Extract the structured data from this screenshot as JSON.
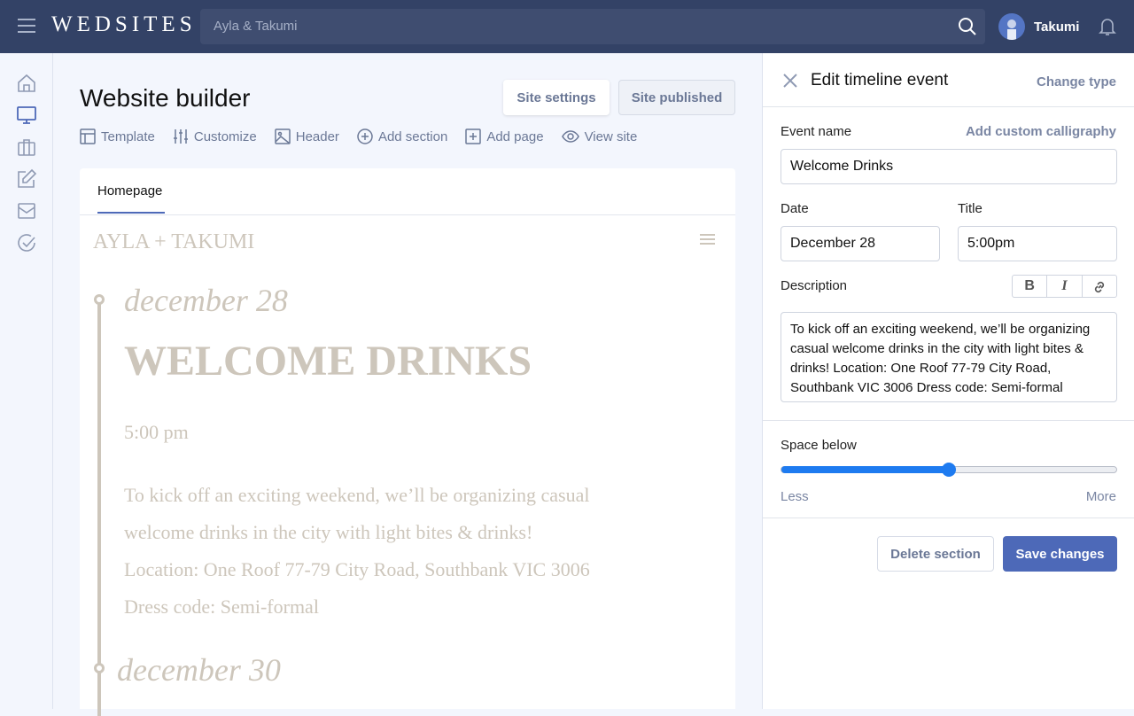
{
  "topbar": {
    "logo": "WEDSITES",
    "search_value": "Ayla & Takumi",
    "user": "Takumi"
  },
  "sidebar": {
    "items": [
      "home-icon",
      "monitor-icon",
      "briefcase-icon",
      "edit-icon",
      "mail-icon",
      "check-circle-icon"
    ],
    "active": "monitor-icon"
  },
  "main": {
    "title": "Website builder",
    "site_settings": "Site settings",
    "site_published": "Site published",
    "tools": [
      "Template",
      "Customize",
      "Header",
      "Add section",
      "Add page",
      "View site"
    ],
    "tab": "Homepage"
  },
  "preview": {
    "couple": "AYLA + TAKUMI",
    "date": "december 28",
    "event": "WELCOME DRINKS",
    "time": "5:00 pm",
    "description": [
      "To kick off an exciting weekend, we’ll be organizing casual",
      "welcome drinks in the city with light bites & drinks!",
      "Location: One Roof 77-79 City Road, Southbank VIC 3006",
      "Dress code: Semi-formal"
    ],
    "next_date": "december 30"
  },
  "panel": {
    "title": "Edit timeline event",
    "change_type": "Change type",
    "event_name_label": "Event name",
    "custom_calligraphy": "Add custom calligraphy",
    "event_name": "Welcome Drinks",
    "date_label": "Date",
    "date": "December 28",
    "title_label": "Title",
    "title_value": "5:00pm",
    "description_label": "Description",
    "description": "To kick off an exciting weekend, we’ll be organizing casual welcome drinks in the city with light bites & drinks! Location: One Roof 77-79 City Road, Southbank VIC 3006 Dress code: Semi-formal",
    "space_below_label": "Space below",
    "space_below_percent": 50,
    "less": "Less",
    "more": "More",
    "delete": "Delete section",
    "save": "Save changes"
  },
  "colors": {
    "topbar": "#334266",
    "accent": "#4d69b8",
    "slider": "#1e7bf0",
    "preview_text": "#cdc6bb"
  }
}
